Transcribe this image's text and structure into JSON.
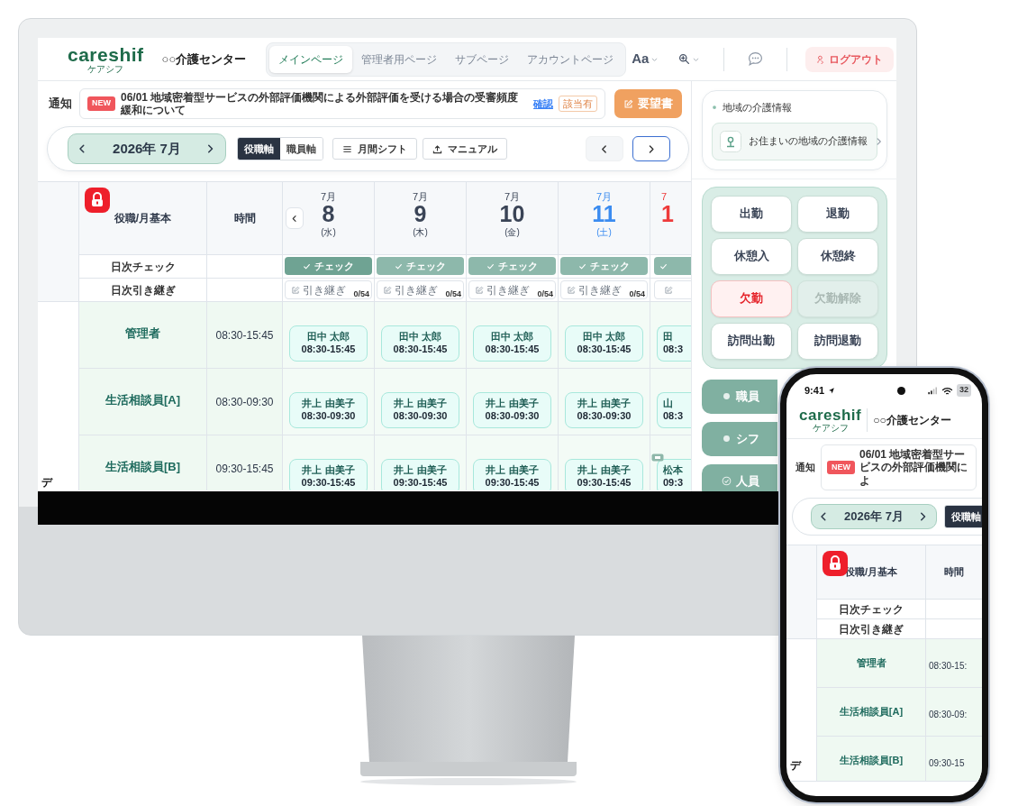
{
  "desktop": {
    "logo": "careshif",
    "logo_sub": "ケアシフ",
    "facility": "○○介護センター",
    "nav_tabs": [
      {
        "label": "メインページ",
        "selected": true
      },
      {
        "label": "管理者用ページ",
        "selected": false
      },
      {
        "label": "サブページ",
        "selected": false
      },
      {
        "label": "アカウントページ",
        "selected": false
      }
    ],
    "font_button": "Aa",
    "logout": "ログアウト",
    "notice": {
      "label": "通知",
      "badge": "NEW",
      "text": "06/01 地域密着型サービスの外部評価機関による外部評価を受ける場合の受審頻度緩和について",
      "confirm": "確認",
      "tag": "該当有"
    },
    "request_button": "要望書",
    "month": "2026年 7月",
    "axis_toggle": [
      {
        "label": "役職軸",
        "selected": true
      },
      {
        "label": "職員軸",
        "selected": false
      }
    ],
    "tool_buttons": [
      {
        "label": "月間シフト",
        "kind": "list"
      },
      {
        "label": "マニュアル",
        "kind": "upload"
      }
    ],
    "table": {
      "locked": true,
      "columns": [
        "役職/月基本",
        "時間"
      ],
      "row_labels": [
        "日次チェック",
        "日次引き継ぎ"
      ],
      "side_label": "デ",
      "days": [
        {
          "month": "7月",
          "day": "8",
          "weekday": "(水)",
          "kind": "weekday",
          "check": "チェック",
          "check_active": true,
          "handover": "引き継ぎ",
          "count": "0/54"
        },
        {
          "month": "7月",
          "day": "9",
          "weekday": "(木)",
          "kind": "weekday",
          "check": "チェック",
          "check_active": false,
          "handover": "引き継ぎ",
          "count": "0/54"
        },
        {
          "month": "7月",
          "day": "10",
          "weekday": "(金)",
          "kind": "weekday",
          "check": "チェック",
          "check_active": false,
          "handover": "引き継ぎ",
          "count": "0/54"
        },
        {
          "month": "7月",
          "day": "11",
          "weekday": "(土)",
          "kind": "saturday",
          "check": "チェック",
          "check_active": false,
          "handover": "引き継ぎ",
          "count": "0/54"
        },
        {
          "month": "7",
          "day": "1",
          "kind": "sunday",
          "check_active": false
        }
      ],
      "rows": [
        {
          "role": "管理者",
          "time": "08:30-15:45",
          "shifts": [
            {
              "name": "田中 太郎",
              "time": "08:30-15:45",
              "badge": false
            },
            {
              "name": "田中 太郎",
              "time": "08:30-15:45",
              "badge": false
            },
            {
              "name": "田中 太郎",
              "time": "08:30-15:45",
              "badge": false
            },
            {
              "name": "田中 太郎",
              "time": "08:30-15:45",
              "badge": false
            },
            {
              "name": "田",
              "time": "08:3",
              "badge": false
            }
          ]
        },
        {
          "role": "生活相談員[A]",
          "time": "08:30-09:30",
          "shifts": [
            {
              "name": "井上 由美子",
              "time": "08:30-09:30",
              "badge": false
            },
            {
              "name": "井上 由美子",
              "time": "08:30-09:30",
              "badge": false
            },
            {
              "name": "井上 由美子",
              "time": "08:30-09:30",
              "badge": false
            },
            {
              "name": "井上 由美子",
              "time": "08:30-09:30",
              "badge": false
            },
            {
              "name": "山",
              "time": "08:3",
              "badge": false
            }
          ]
        },
        {
          "role": "生活相談員[B]",
          "time": "09:30-15:45",
          "shifts": [
            {
              "name": "井上 由美子",
              "time": "09:30-15:45",
              "badge": false
            },
            {
              "name": "井上 由美子",
              "time": "09:30-15:45",
              "badge": false
            },
            {
              "name": "井上 由美子",
              "time": "09:30-15:45",
              "badge": false
            },
            {
              "name": "井上 由美子",
              "time": "09:30-15:45",
              "badge": false
            },
            {
              "name": "松本",
              "time": "09:3",
              "badge": true
            }
          ]
        }
      ]
    },
    "region_info": {
      "title": "地域の介護情報",
      "link": "お住まいの地域の介護情報"
    },
    "punch_buttons": [
      {
        "label": "出勤",
        "kind": "normal"
      },
      {
        "label": "退勤",
        "kind": "normal"
      },
      {
        "label": "休憩入",
        "kind": "normal"
      },
      {
        "label": "休憩終",
        "kind": "normal"
      },
      {
        "label": "欠勤",
        "kind": "danger"
      },
      {
        "label": "欠勤解除",
        "kind": "muted"
      },
      {
        "label": "訪問出勤",
        "kind": "normal"
      },
      {
        "label": "訪問退勤",
        "kind": "normal"
      }
    ],
    "menu_buttons": [
      {
        "label": "職員",
        "kind": "dot"
      },
      {
        "label": "シフ",
        "kind": "dot"
      },
      {
        "label": "人員",
        "kind": "check"
      }
    ]
  },
  "phone": {
    "status_time": "9:41",
    "battery": "32",
    "logo": "careshif",
    "logo_sub": "ケアシフ",
    "facility": "○○介護センター",
    "notice": {
      "label": "通知",
      "badge": "NEW",
      "text": "06/01 地域密着型サービスの外部評価機関によ"
    },
    "month": "2026年 7月",
    "axis_toggle": [
      {
        "label": "役職軸",
        "selected": true
      }
    ],
    "table": {
      "locked": true,
      "columns": [
        "役職/月基本",
        "時間"
      ],
      "row_labels": [
        "日次チェック",
        "日次引き継ぎ"
      ],
      "side_label": "デ",
      "rows": [
        {
          "role": "管理者",
          "time": "08:30-15:"
        },
        {
          "role": "生活相談員[A]",
          "time": "08:30-09:"
        },
        {
          "role": "生活相談員[B]",
          "time": "09:30-15"
        }
      ]
    }
  }
}
